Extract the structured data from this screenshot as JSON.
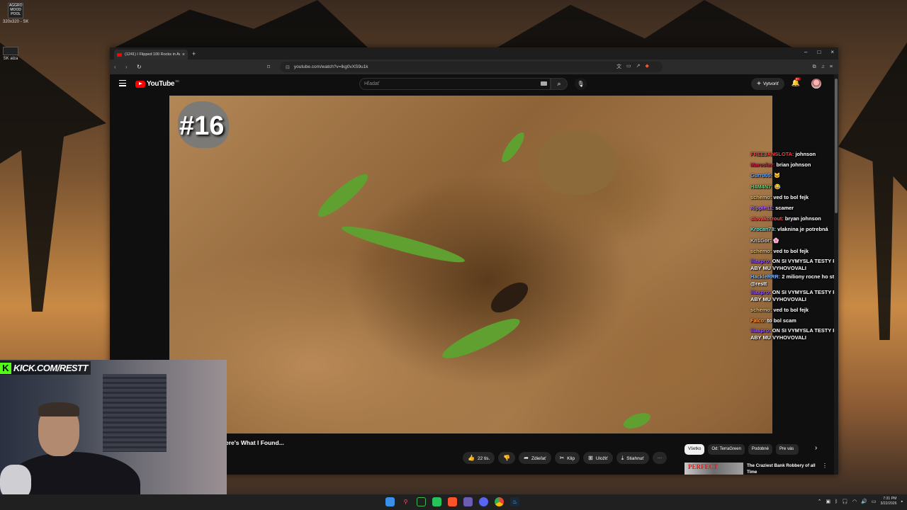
{
  "desktop": {
    "icons": [
      {
        "label": "320x320 - SK",
        "thumb": "AGGRO MOOD POOL"
      },
      {
        "label": "SK alza",
        "thumb": "SK alza"
      }
    ]
  },
  "browser": {
    "tab_title": "(1241) I Flipped 100 Rocks in Au",
    "tab_close": "×",
    "new_tab": "+",
    "url": "youtube.com/watch?v=lkg0vXS9u1k",
    "window_controls": {
      "minimize": "–",
      "maximize": "□",
      "close": "×"
    }
  },
  "youtube": {
    "logo_text": "YouTube",
    "country_code": "SK",
    "search_placeholder": "Hľadať",
    "create_label": "Vytvoriť",
    "notification_count": "9+"
  },
  "video": {
    "episode_label": "#16",
    "title": "ere's What I Found..."
  },
  "chat": [
    {
      "user": "FREEJANSLOTA:",
      "msg": "johnson",
      "color": "#ff3b3b"
    },
    {
      "user": "Maroslav:",
      "msg": "brian johnson",
      "color": "#d4214a"
    },
    {
      "user": "Gurru05:",
      "msg": "🐱",
      "color": "#6da7ff"
    },
    {
      "user": "H4M4N7:",
      "msg": "😂",
      "color": "#58d96a"
    },
    {
      "user": "schemo:",
      "msg": "ved to bol fejk",
      "color": "#e3c17a"
    },
    {
      "user": "Rippin11:",
      "msg": "scamer",
      "color": "#b46bff"
    },
    {
      "user": "slovakotrout:",
      "msg": "bryan johnson",
      "color": "#ff5a5a"
    },
    {
      "user": "Krocan78:",
      "msg": "vlaknina je potrebná",
      "color": "#5fe3d3"
    },
    {
      "user": "Kn1Gor:",
      "msg": "🌸",
      "color": "#c9c9c9"
    },
    {
      "user": "schemo:",
      "msg": "ved to bol fejk",
      "color": "#e3c17a"
    },
    {
      "user": "lilaxpro:",
      "msg": "ON SI VYMYSLA TESTY PODLA SEBA ABY MU VYHOVOVALI",
      "color": "#9b5cff"
    },
    {
      "user": "HackleRRR:",
      "msg": "2 miliony rocne ho stoji ten lifestyle @restt",
      "color": "#7ab8ff"
    },
    {
      "user": "lilaxpro:",
      "msg": "ON SI VYMYSLA TESTY PODLA SEBA ABY MU VYHOVOVALI",
      "color": "#9b5cff"
    },
    {
      "user": "schemo:",
      "msg": "ved to bol fejk",
      "color": "#e3c17a"
    },
    {
      "user": "Falco:",
      "msg": "to bol scam",
      "color": "#ff9a3b"
    },
    {
      "user": "lilaxpro:",
      "msg": "ON SI VYMYSLA TESTY PODLA SEBA ABY MU VYHOVOVALI",
      "color": "#9b5cff"
    }
  ],
  "actions": {
    "likes": "22 tis.",
    "share": "Zdieľať",
    "clip": "Klip",
    "save": "Uložiť",
    "download": "Stiahnuť",
    "more": "···"
  },
  "chips": [
    "Všetko",
    "Od: TerraGreen",
    "Podobné",
    "Pre vás"
  ],
  "recommendation": {
    "thumb_text": "PERFECT",
    "title": "The Craziest Bank Robbery of all Time"
  },
  "stream": {
    "overlay_text": "KICK.COM/RESTT",
    "k_logo": "K"
  },
  "taskbar": {
    "time": "7:31 PM",
    "date": "3/22/2026"
  }
}
